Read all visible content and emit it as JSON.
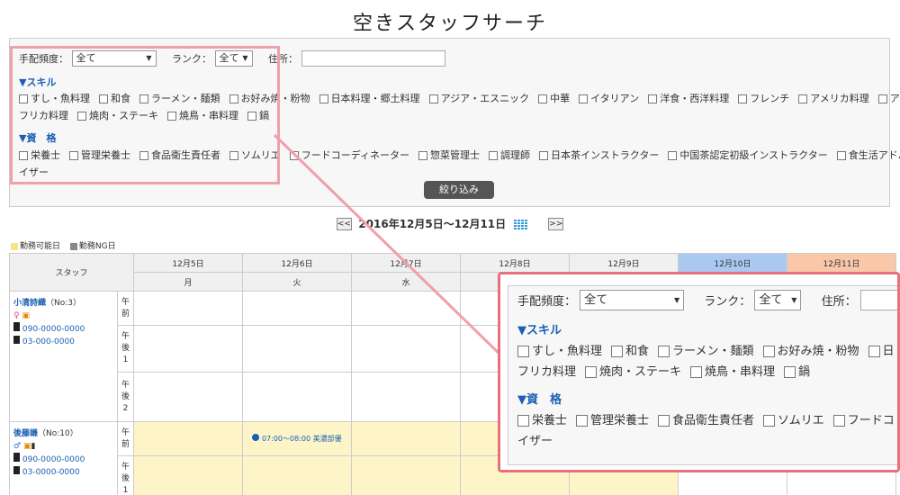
{
  "title": "空きスタッフサーチ",
  "filter": {
    "freq_label": "手配頻度：",
    "freq_value": "全て",
    "rank_label": "ランク：",
    "rank_value": "全て",
    "address_label": "住所：",
    "address_value": "",
    "skill_header": "▼スキル",
    "skills": [
      "すし・魚料理",
      "和食",
      "ラーメン・麺類",
      "お好み焼・粉物",
      "日本料理・郷土料理",
      "アジア・エスニック",
      "中華",
      "イタリアン",
      "洋食・西洋料理",
      "フレンチ",
      "アメリカ料理",
      "ア",
      "フリカ料理",
      "焼肉・ステーキ",
      "焼鳥・串料理",
      "鍋"
    ],
    "qual_header": "▼資　格",
    "quals": [
      "栄養士",
      "管理栄養士",
      "食品衛生責任者",
      "ソムリエ",
      "フードコーディネーター",
      "惣菜管理士",
      "調理師",
      "日本茶インストラクター",
      "中国茶認定初級インストラクター",
      "食生活アドバイ",
      "イザー"
    ],
    "submit_label": "絞り込み"
  },
  "nav": {
    "prev": "<<",
    "range": "2016年12月5日〜12月11日",
    "next": ">>"
  },
  "legend": {
    "ok": "勤務可能日",
    "ng": "勤務NG日",
    "ok_color": "#f5e48a",
    "ng_color": "#888888"
  },
  "calendar": {
    "staff_header": "スタッフ",
    "dates": [
      "12月5日",
      "12月6日",
      "12月7日",
      "12月8日",
      "12月9日",
      "12月10日",
      "12月11日"
    ],
    "weekdays": [
      "月",
      "火",
      "水",
      "",
      "",
      "",
      ""
    ],
    "sat_color": "#aac8f0",
    "sun_color": "#f8c8a8",
    "staff": [
      {
        "name": "小清詩織",
        "no": "（No:3）",
        "mobile": "090-0000-0000",
        "tel": "03-000-0000",
        "periods": [
          "午\n前",
          "午\n後\n1",
          "午\n後\n2"
        ]
      },
      {
        "name": "後藤謙",
        "no": "（No:10）",
        "mobile": "090-0000-0000",
        "tel": "03-0000-0000",
        "periods": [
          "午\n前",
          "午\n後\n1"
        ],
        "shift": "07:00〜08:00 美濃部優"
      }
    ]
  },
  "zoom": {
    "freq_label": "手配頻度：",
    "freq_value": "全て",
    "rank_label": "ランク：",
    "rank_value": "全て",
    "address_label": "住所：",
    "skill_header": "▼スキル",
    "skills_row1": [
      "すし・魚料理",
      "和食",
      "ラーメン・麺類",
      "お好み焼・粉物",
      "日"
    ],
    "skills_row2": [
      "フリカ料理",
      "焼肉・ステーキ",
      "焼鳥・串料理",
      "鍋"
    ],
    "qual_header": "▼資　格",
    "quals_row1": [
      "栄養士",
      "管理栄養士",
      "食品衛生責任者",
      "ソムリエ",
      "フードコ"
    ],
    "quals_row2": [
      "イザー"
    ]
  }
}
